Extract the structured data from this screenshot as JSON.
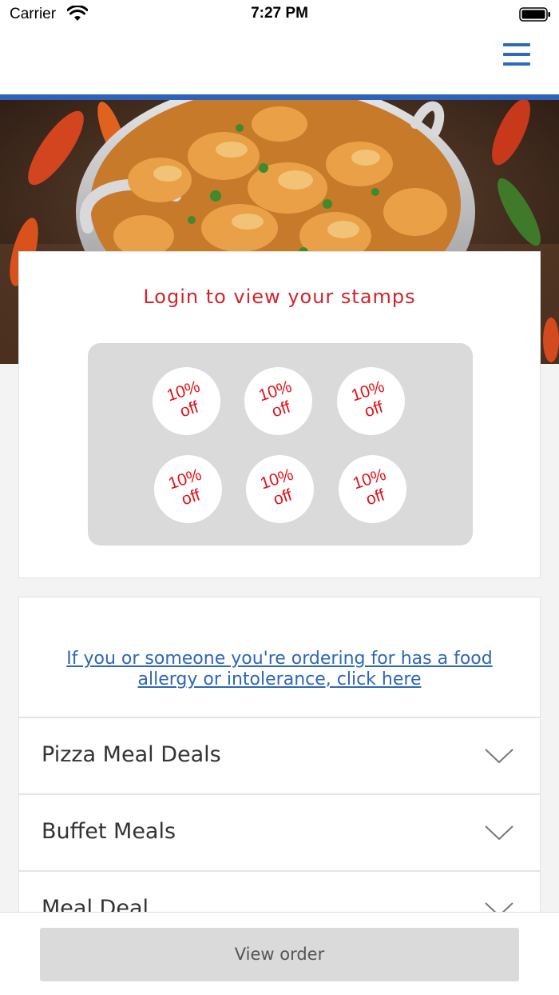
{
  "status_bar": {
    "carrier": "Carrier",
    "time": "7:27 PM"
  },
  "header": {
    "menu_icon": "hamburger-menu-icon",
    "accent_color": "#2f63b8"
  },
  "hero": {
    "image": "curry-dish-in-metal-bowl"
  },
  "stamps": {
    "title": "Login to view your stamps",
    "title_color": "#d1242b",
    "items": [
      {
        "line1": "10%",
        "line2": "off"
      },
      {
        "line1": "10%",
        "line2": "off"
      },
      {
        "line1": "10%",
        "line2": "off"
      },
      {
        "line1": "10%",
        "line2": "off"
      },
      {
        "line1": "10%",
        "line2": "off"
      },
      {
        "line1": "10%",
        "line2": "off"
      }
    ]
  },
  "menu": {
    "allergy_link": "If you or someone you're ordering for has a food allergy or intolerance, click here",
    "categories": [
      {
        "label": "Pizza Meal Deals"
      },
      {
        "label": "Buffet Meals"
      },
      {
        "label": "Meal Deal"
      }
    ]
  },
  "footer": {
    "view_order_label": "View order"
  }
}
